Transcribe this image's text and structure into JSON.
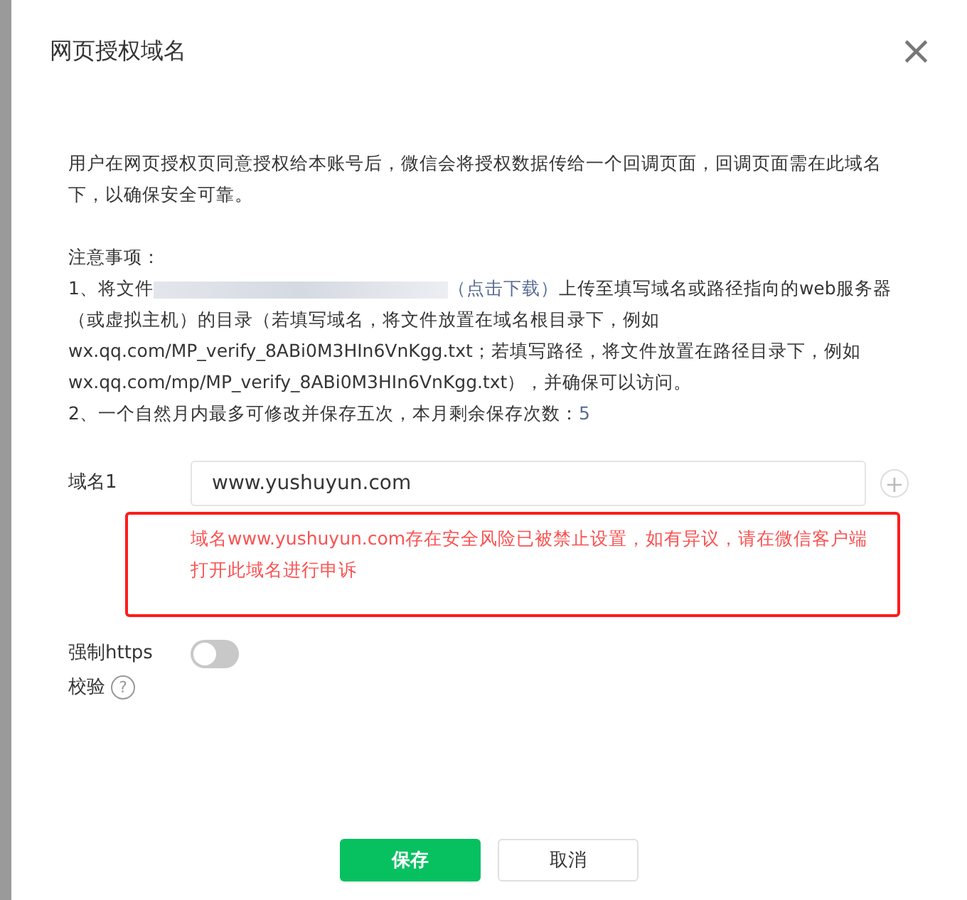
{
  "dialog": {
    "title": "网页授权域名",
    "close": "×"
  },
  "description": "用户在网页授权页同意授权给本账号后，微信会将授权数据传给一个回调页面，回调页面需在此域名下，以确保安全可靠。",
  "notes": {
    "heading": "注意事项：",
    "items": [
      {
        "kind": "file",
        "prefix": "1、将文件",
        "redacted": true,
        "link": "（点击下载）",
        "suffix": "上传至填写域名或路径指向的web服务器（或虚拟主机）的目录（若填写域名，将文件放置在域名根目录下，例如wx.qq.com/MP_verify_8ABi0M3HIn6VnKgg.txt；若填写路径，将文件放置在路径目录下，例如wx.qq.com/mp/MP_verify_8ABi0M3HIn6VnKgg.txt），并确保可以访问。"
      },
      {
        "kind": "count",
        "prefix": "2、一个自然月内最多可修改并保存五次，本月剩余保存次数：",
        "count": "5"
      }
    ]
  },
  "domain": {
    "label": "域名1",
    "value": "www.yushuyun.com",
    "add": "+",
    "error": "域名www.yushuyun.com存在安全风险已被禁止设置，如有异议，请在微信客户端打开此域名进行申诉",
    "highlighted": true
  },
  "https": {
    "label": "强制https校验",
    "help": "?",
    "on": false
  },
  "buttons": [
    {
      "label": "保存",
      "kind": "primary"
    },
    {
      "label": "取消",
      "kind": "default"
    }
  ]
}
